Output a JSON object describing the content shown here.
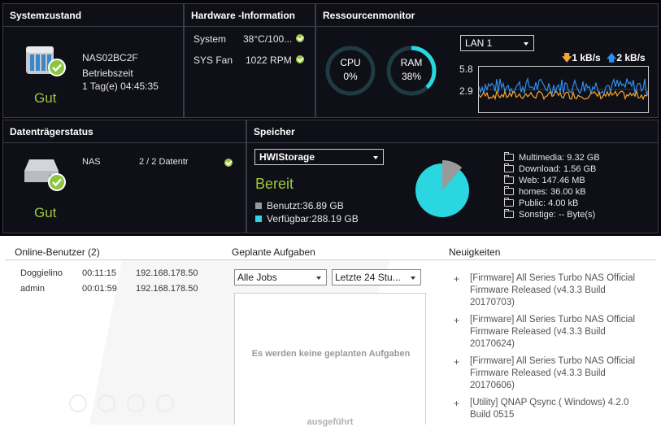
{
  "colors": {
    "good": "#9ec93c",
    "accent": "#2ad7e0",
    "used": "#9a9a9a",
    "upload": "#f4a531",
    "download": "#2e8ff0"
  },
  "systemzustand": {
    "title": "Systemzustand",
    "device_name": "NAS02BC2F",
    "uptime_label": "Betriebszeit",
    "uptime_value": "1 Tag(e) 04:45:35",
    "status": "Gut",
    "icon": "nas-device-icon"
  },
  "hardware": {
    "title": "Hardware -Information",
    "rows": [
      {
        "label": "System",
        "value": "38°C/100..."
      },
      {
        "label": "SYS Fan",
        "value": "1022 RPM"
      }
    ]
  },
  "ressourcen": {
    "title": "Ressourcenmonitor",
    "cpu": {
      "label": "CPU",
      "value": "0%",
      "percent": 0
    },
    "ram": {
      "label": "RAM",
      "value": "38%",
      "percent": 38
    },
    "lan_select": "LAN 1",
    "upload": "1 kB/s",
    "download": "2 kB/s",
    "y_max": "5.8",
    "y_mid": "2.9"
  },
  "datentraeger": {
    "title": "Datenträgerstatus",
    "name": "NAS",
    "disks": "2 / 2 Datentr",
    "status": "Gut"
  },
  "speicher": {
    "title": "Speicher",
    "pool_select": "HWIStorage",
    "state": "Bereit",
    "used": "Benutzt:36.89 GB",
    "free": "Verfügbar:288.19 GB",
    "used_fraction": 0.113,
    "folders": [
      "Multimedia: 9.32 GB",
      "Download: 1.56 GB",
      "Web: 147.46 MB",
      "homes: 36.00 kB",
      "Public: 4.00 kB",
      "Sonstige: -- Byte(s)"
    ]
  },
  "online_users": {
    "title": "Online-Benutzer (2)",
    "rows": [
      {
        "user": "Doggielino",
        "time": "00:11:15",
        "ip": "192.168.178.50"
      },
      {
        "user": "admin",
        "time": "00:01:59",
        "ip": "192.168.178.50"
      }
    ]
  },
  "aufgaben": {
    "title": "Geplante Aufgaben",
    "jobs_select": "Alle Jobs",
    "period_select": "Letzte 24 Stu...",
    "empty_line1": "Es werden keine geplanten Aufgaben",
    "empty_line2": "ausgeführt"
  },
  "news": {
    "title": "Neuigkeiten",
    "items": [
      "[Firmware] All Series Turbo NAS Official Firmware Released (v4.3.3 Build 20170703)",
      "[Firmware] All Series Turbo NAS Official Firmware Released (v4.3.3 Build 20170624)",
      "[Firmware] All Series Turbo NAS Official Firmware Released (v4.3.3 Build 20170606)",
      "[Utility] QNAP Qsync ( Windows) 4.2.0 Build 0515"
    ]
  }
}
